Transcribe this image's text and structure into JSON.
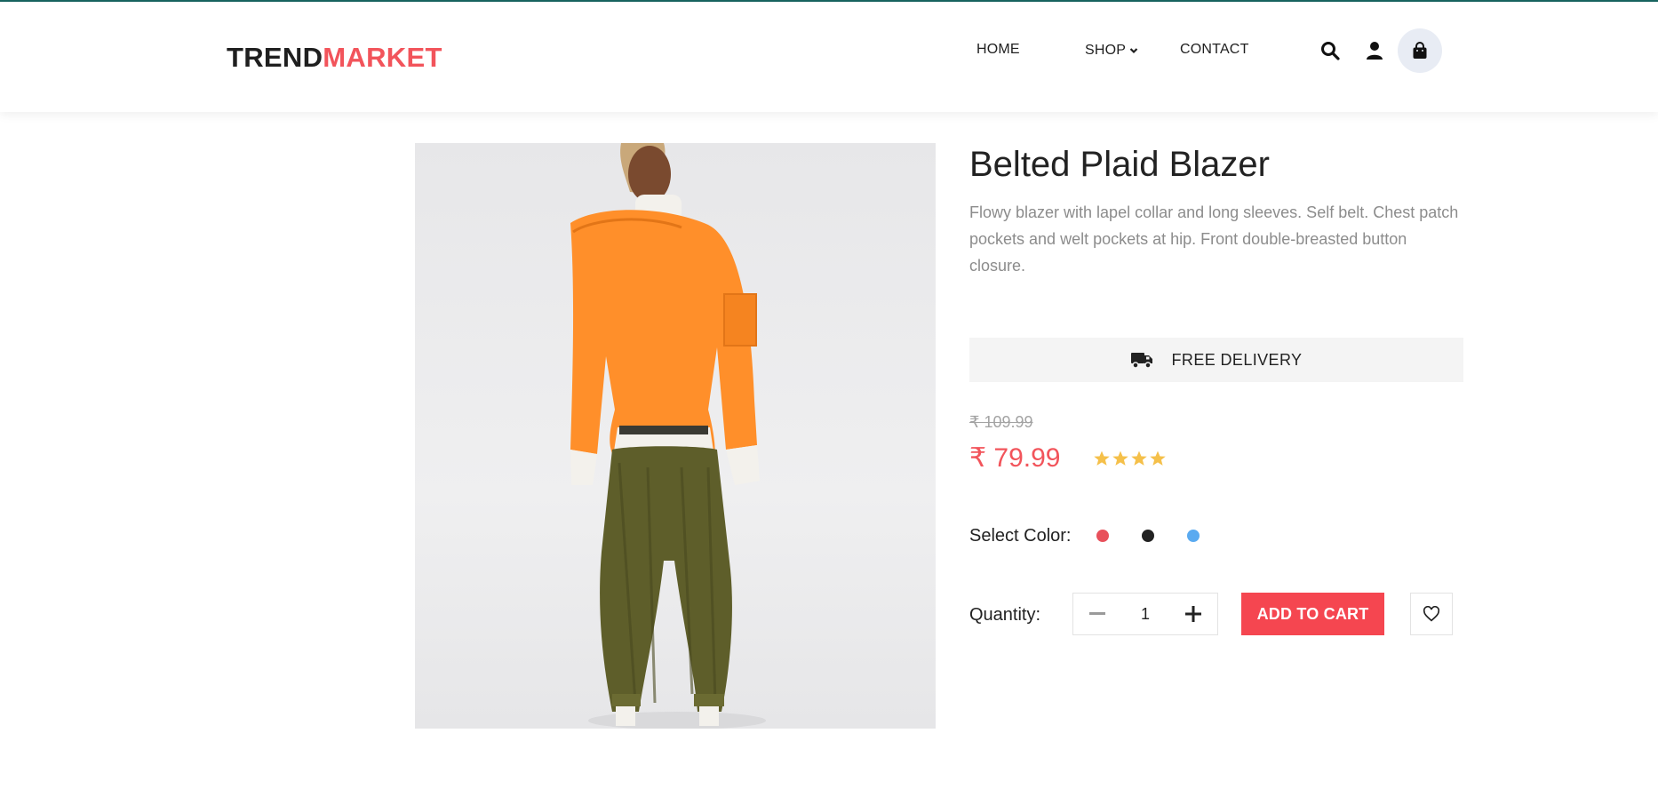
{
  "header": {
    "logo_part1": "TREND",
    "logo_part2": "MARKET",
    "nav": {
      "home": "HOME",
      "shop": "SHOP",
      "contact": "CONTACT"
    }
  },
  "product": {
    "title": "Belted Plaid Blazer",
    "description": "Flowy blazer with lapel collar and long sleeves. Self belt. Chest patch pockets and welt pockets at hip. Front double-breasted button closure.",
    "delivery": "FREE DELIVERY",
    "old_price": "₹ 109.99",
    "price": "₹ 79.99",
    "rating": 4,
    "select_color_label": "Select Color:",
    "colors": [
      "#e8505b",
      "#222222",
      "#5aaaf0"
    ],
    "quantity_label": "Quantity:",
    "quantity": "1",
    "add_to_cart": "ADD TO CART"
  },
  "icons": {
    "search": "search-icon",
    "user": "user-icon",
    "cart": "shopping-bag-icon",
    "truck": "truck-icon",
    "heart": "heart-icon",
    "minus": "minus-icon",
    "plus": "plus-icon",
    "chevron": "chevron-down-icon"
  },
  "theme": {
    "accent": "#f2545b",
    "button": "#f54650",
    "topline": "#17645f",
    "star": "#f5c04a"
  }
}
